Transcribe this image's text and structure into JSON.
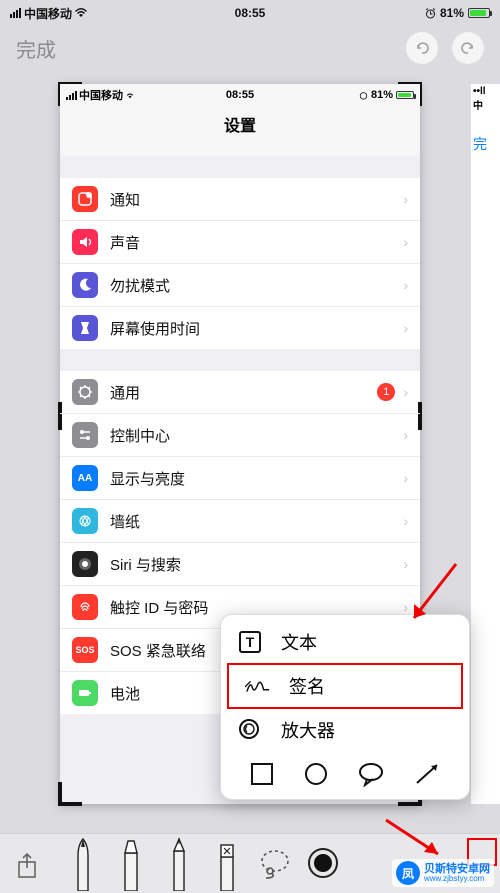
{
  "outer_status": {
    "carrier": "中国移动",
    "time": "08:55",
    "battery_pct": "81%"
  },
  "nav": {
    "done": "完成"
  },
  "inner_status": {
    "carrier": "中国移动",
    "time": "08:55",
    "battery_pct": "81%"
  },
  "inner_title": "设置",
  "group1": [
    {
      "label": "通知",
      "color": "#ff3b30"
    },
    {
      "label": "声音",
      "color": "#ff2d55"
    },
    {
      "label": "勿扰模式",
      "color": "#5856d6"
    },
    {
      "label": "屏幕使用时间",
      "color": "#5856d6"
    }
  ],
  "group2": [
    {
      "label": "通用",
      "color": "#8e8e93",
      "badge": "1"
    },
    {
      "label": "控制中心",
      "color": "#8e8e93"
    },
    {
      "label": "显示与亮度",
      "color": "#0a7cff"
    },
    {
      "label": "墙纸",
      "color": "#2fb7e0"
    },
    {
      "label": "Siri 与搜索",
      "color": "#222"
    },
    {
      "label": "触控 ID 与密码",
      "color": "#ff3b30"
    },
    {
      "label": "SOS 紧急联络",
      "color": "#ff3b30"
    },
    {
      "label": "电池",
      "color": "#4cd964"
    }
  ],
  "popup": {
    "text": "文本",
    "signature": "签名",
    "magnifier": "放大器"
  },
  "peek": {
    "carrier_partial": "中",
    "done": "完"
  },
  "watermark": {
    "name": "贝斯特安卓网",
    "url": "www.zjbstyy.com"
  }
}
